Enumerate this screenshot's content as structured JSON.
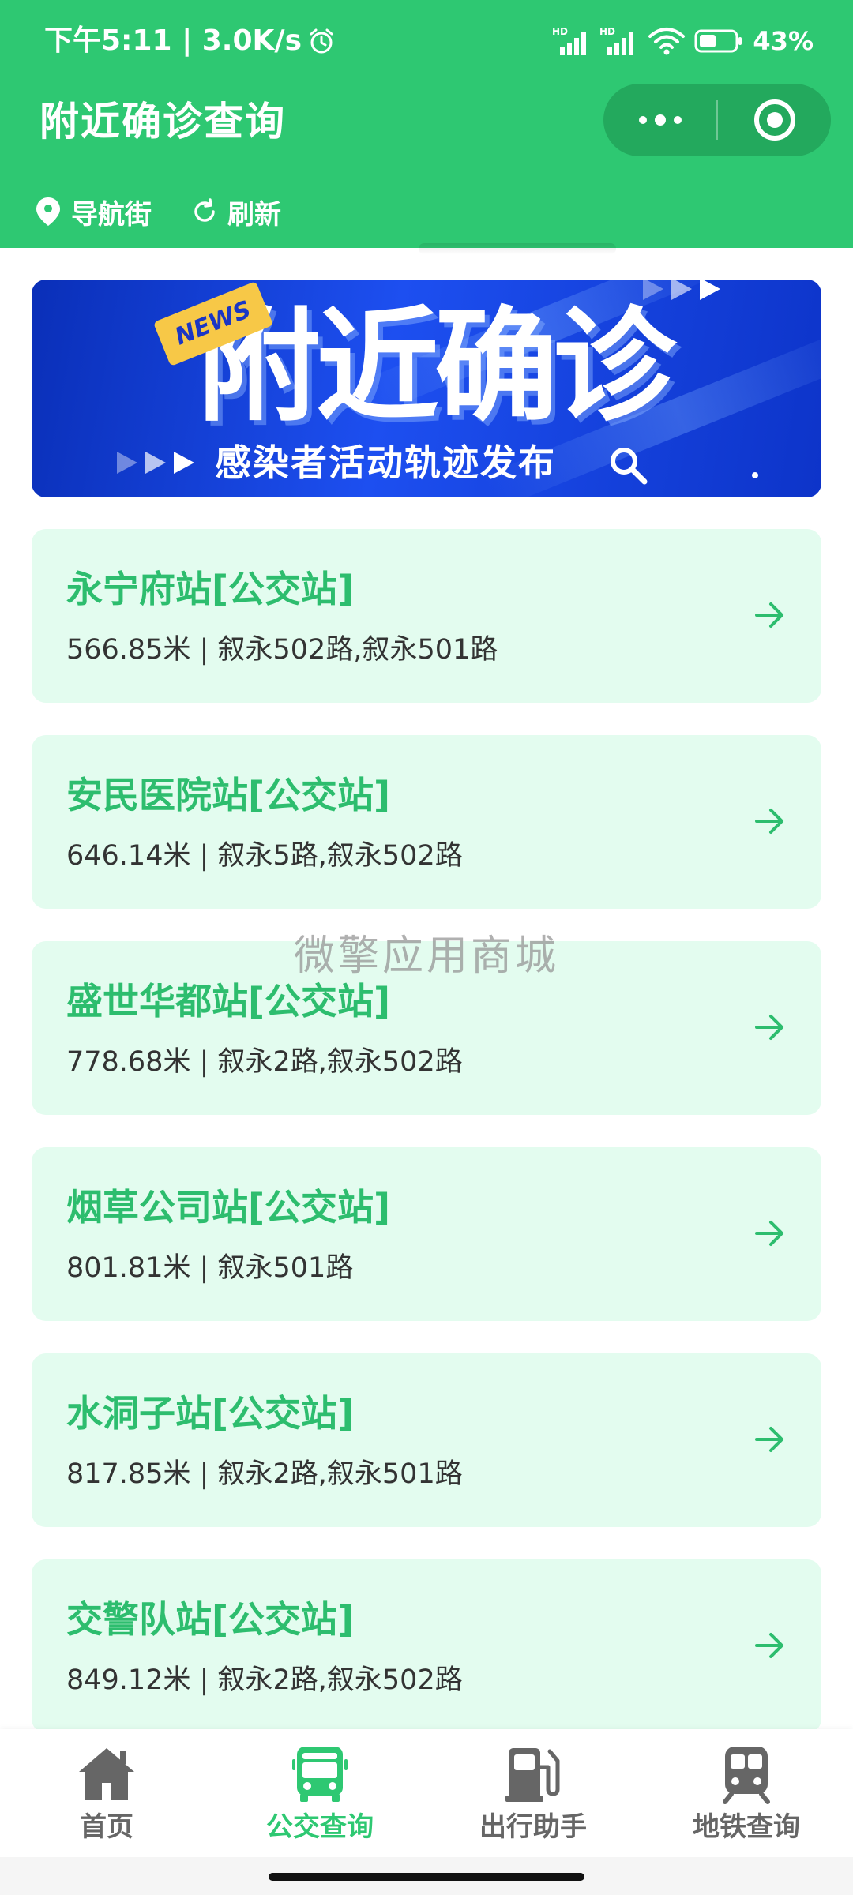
{
  "status_bar": {
    "time_speed": "下午5:11 | 3.0K/s",
    "battery": "43%"
  },
  "header": {
    "title": "附近确诊查询",
    "location_label": "导航街",
    "refresh_label": "刷新"
  },
  "banner": {
    "news_tag": "NEWS",
    "title": "附近确诊",
    "subtitle": "感染者活动轨迹发布"
  },
  "stops": [
    {
      "name": "永宁府站[公交站]",
      "info": "566.85米 | 叙永502路,叙永501路"
    },
    {
      "name": "安民医院站[公交站]",
      "info": "646.14米 | 叙永5路,叙永502路"
    },
    {
      "name": "盛世华都站[公交站]",
      "info": "778.68米 | 叙永2路,叙永502路"
    },
    {
      "name": "烟草公司站[公交站]",
      "info": "801.81米 | 叙永501路"
    },
    {
      "name": "水洞子站[公交站]",
      "info": "817.85米 | 叙永2路,叙永501路"
    },
    {
      "name": "交警队站[公交站]",
      "info": "849.12米 | 叙永2路,叙永502路"
    }
  ],
  "watermark": "微擎应用商城",
  "tabs": [
    {
      "label": "首页",
      "icon": "home-icon"
    },
    {
      "label": "公交查询",
      "icon": "bus-icon"
    },
    {
      "label": "出行助手",
      "icon": "gas-station-icon"
    },
    {
      "label": "地铁查询",
      "icon": "subway-icon"
    }
  ],
  "colors": {
    "brand_green": "#2ec872",
    "card_bg": "#e3fcef",
    "tab_inactive": "#666666"
  }
}
